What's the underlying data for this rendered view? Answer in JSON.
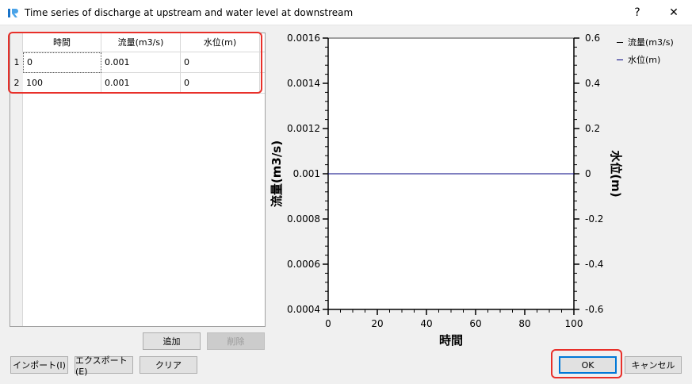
{
  "window": {
    "title": "Time series of discharge at upstream and water level at downstream",
    "help_label": "?",
    "close_label": "✕"
  },
  "table": {
    "columns": [
      "時間",
      "流量(m3/s)",
      "水位(m)"
    ],
    "rows": [
      {
        "num": "1",
        "cells": [
          "0",
          "0.001",
          "0"
        ]
      },
      {
        "num": "2",
        "cells": [
          "100",
          "0.001",
          "0"
        ]
      }
    ]
  },
  "buttons": {
    "add": "追加",
    "delete": "削除",
    "import": "インポート(I)",
    "export": "エクスポート(E)",
    "clear": "クリア",
    "ok": "OK",
    "cancel": "キャンセル"
  },
  "chart_data": {
    "type": "line",
    "xlabel": "時間",
    "ylabel": "流量(m3/s)",
    "y2label": "水位(m)",
    "xlim": [
      0,
      100
    ],
    "ylim": [
      0.0004,
      0.0016
    ],
    "y2lim": [
      -0.6,
      0.6
    ],
    "x_ticks": [
      "0",
      "20",
      "40",
      "60",
      "80",
      "100"
    ],
    "y_ticks": [
      "0.0004",
      "0.0006",
      "0.0008",
      "0.001",
      "0.0012",
      "0.0014",
      "0.0016"
    ],
    "y2_ticks": [
      "-0.6",
      "-0.4",
      "-0.2",
      "0",
      "0.2",
      "0.4",
      "0.6"
    ],
    "series": [
      {
        "name": "流量(m3/s)",
        "axis": "left",
        "color": "#000000",
        "x": [
          0,
          100
        ],
        "y": [
          0.001,
          0.001
        ]
      },
      {
        "name": "水位(m)",
        "axis": "right",
        "color": "#000080",
        "x": [
          0,
          100
        ],
        "y": [
          0,
          0
        ]
      }
    ],
    "legend": "top-right"
  }
}
